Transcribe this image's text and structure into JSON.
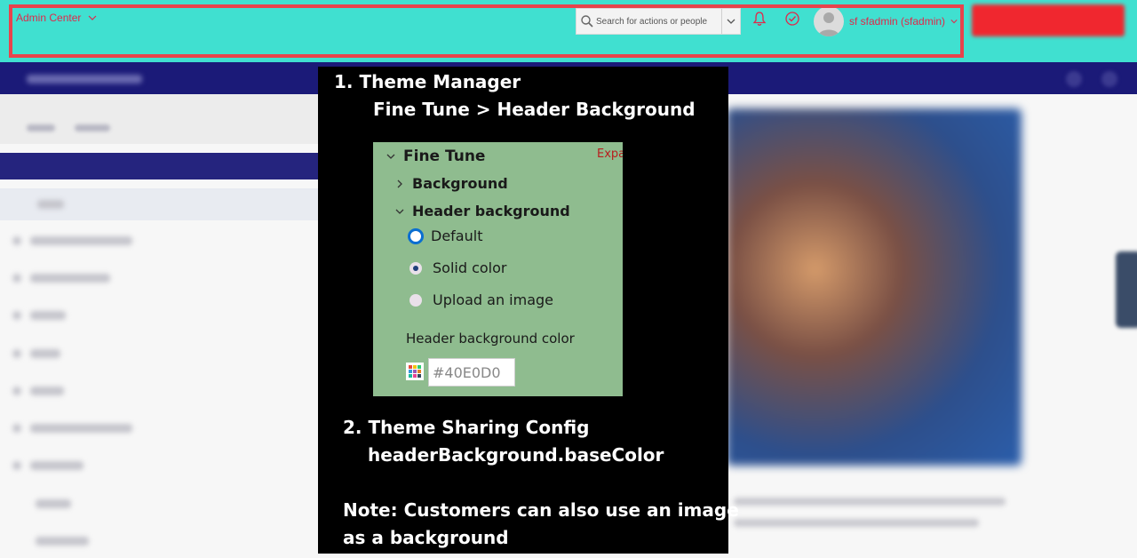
{
  "header": {
    "app_title": "Admin Center",
    "search": {
      "placeholder": "Search for actions or people"
    },
    "user_name": "sf sfadmin (sfadmin)",
    "background_color": "#40E0D0",
    "accent_color": "#e0284a"
  },
  "overlay": {
    "step1_title": "1.  Theme Manager",
    "step1_path": "Fine Tune > Header Background",
    "panel": {
      "section_title": "Fine Tune",
      "expand_label": "Expa",
      "background_item": "Background",
      "header_background_item": "Header background",
      "options": [
        {
          "label": "Default",
          "state": "focused"
        },
        {
          "label": "Solid color",
          "state": "selected"
        },
        {
          "label": "Upload an image",
          "state": "unselected"
        }
      ],
      "color_label": "Header background color",
      "color_value": "#40E0D0"
    },
    "step2_title": "2. Theme Sharing Config",
    "step2_key": "headerBackground.baseColor",
    "note_line1": "Note: Customers can also  use an image",
    "note_line2": "as a background"
  }
}
